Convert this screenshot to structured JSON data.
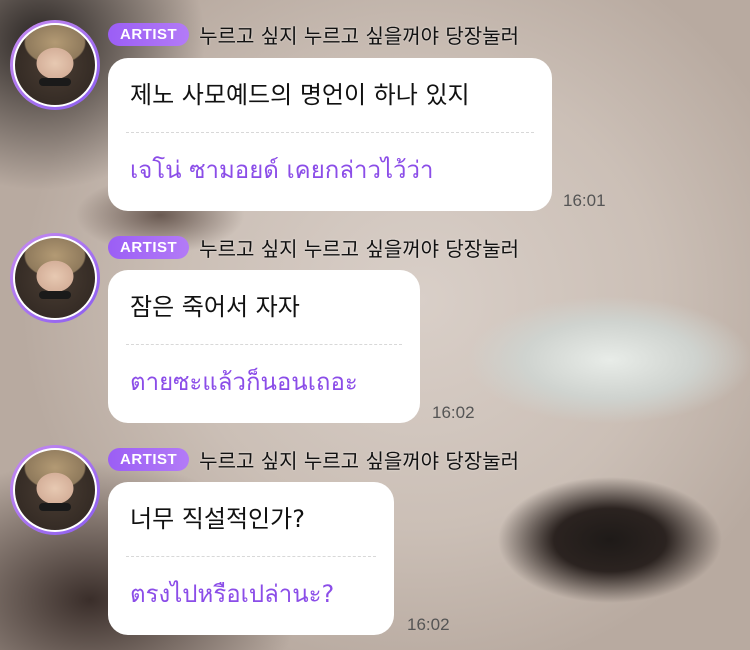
{
  "messages": [
    {
      "badge": "ARTIST",
      "sender": "누르고 싶지 누르고 싶을꺼야 당장눌러",
      "original": "제노 사모예드의 명언이 하나 있지",
      "translation": "เจโน่ ซามอยด์ เคยกล่าวไว้ว่า",
      "time": "16:01"
    },
    {
      "badge": "ARTIST",
      "sender": "누르고 싶지 누르고 싶을꺼야 당장눌러",
      "original": "잠은 죽어서 자자",
      "translation": "ตายซะแล้วก็นอนเถอะ",
      "time": "16:02"
    },
    {
      "badge": "ARTIST",
      "sender": "누르고 싶지 누르고 싶을꺼야 당장눌러",
      "original": "너무 직설적인가?",
      "translation": "ตรงไปหรือเปล่านะ?",
      "time": "16:02"
    }
  ],
  "colors": {
    "badge": "#9b5ef5",
    "translation_text": "#8b4de8",
    "bubble": "#ffffff"
  }
}
